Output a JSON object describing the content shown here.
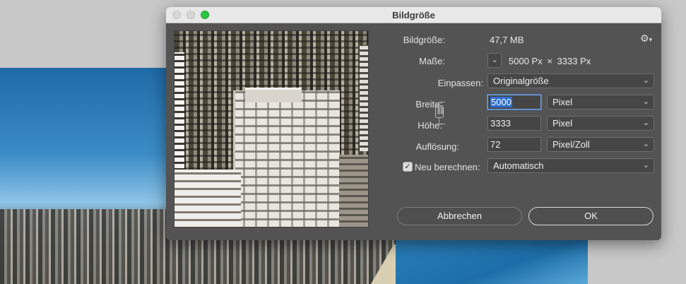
{
  "window": {
    "title": "Bildgröße"
  },
  "form": {
    "image_size_label": "Bildgröße:",
    "image_size_value": "47,7 MB",
    "dimensions_label": "Maße:",
    "dimensions_width": "5000 Px",
    "dimensions_times": "×",
    "dimensions_height": "3333 Px",
    "fit_label": "Einpassen:",
    "fit_value": "Originalgröße",
    "width_label": "Breite:",
    "width_value": "5000",
    "width_unit": "Pixel",
    "height_label": "Höhe:",
    "height_value": "3333",
    "height_unit": "Pixel",
    "resolution_label": "Auflösung:",
    "resolution_value": "72",
    "resolution_unit": "Pixel/Zoll",
    "resample_label": "Neu berechnen:",
    "resample_value": "Automatisch",
    "resample_checked": true
  },
  "buttons": {
    "cancel": "Abbrechen",
    "ok": "OK"
  },
  "icons": {
    "dropdown": "chevron-down-icon",
    "settings": "gear-icon",
    "link": "chain-link-icon",
    "check": "checkmark-icon"
  }
}
